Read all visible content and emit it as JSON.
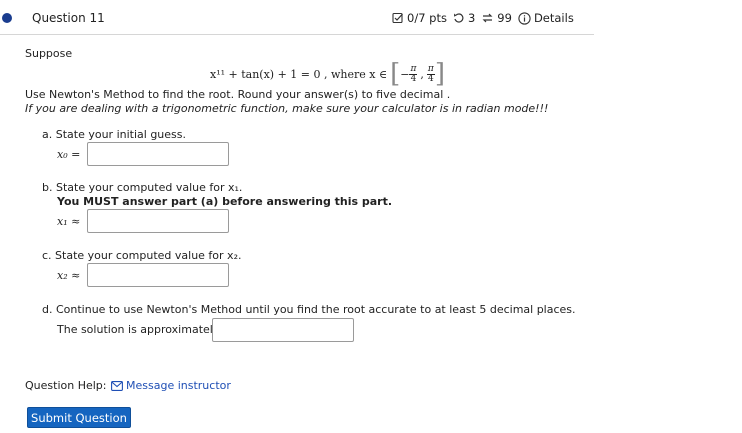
{
  "question": {
    "title": "Question 11"
  },
  "meta": {
    "points": "0/7 pts",
    "retries": "3",
    "attempts": "99",
    "details": "Details"
  },
  "prompt": {
    "suppose": "Suppose",
    "equation": "x¹¹ + tan(x) + 1 = 0 , where x ∈",
    "interval_open": "[",
    "interval_neg": "−",
    "pi": "π",
    "four": "4",
    "interval_close": "]",
    "instruction": "Use Newton's Method to find the root. Round your answer(s) to five decimal .",
    "note": "If you are dealing with a trigonometric function, make sure your calculator is in radian mode!!!"
  },
  "parts": {
    "a": {
      "text": "a. State your initial guess.",
      "label": "x₀ =",
      "value": ""
    },
    "b": {
      "text": "b. State your computed value for x₁.",
      "warning": "You MUST answer part (a) before answering this part.",
      "label": "x₁ ≈",
      "value": ""
    },
    "c": {
      "text": "c. State your computed value for x₂.",
      "label": "x₂ ≈",
      "value": ""
    },
    "d": {
      "text": "d. Continue to use Newton's Method until you find the root accurate to at least 5 decimal places.",
      "label": "The solution is approximately",
      "value": ""
    }
  },
  "help": {
    "label": "Question Help:",
    "link": "Message instructor"
  },
  "submit": {
    "label": "Submit Question"
  },
  "colors": {
    "accent": "#1565c0",
    "status_dot": "#1a3d8f",
    "link": "#1f4fb5"
  }
}
